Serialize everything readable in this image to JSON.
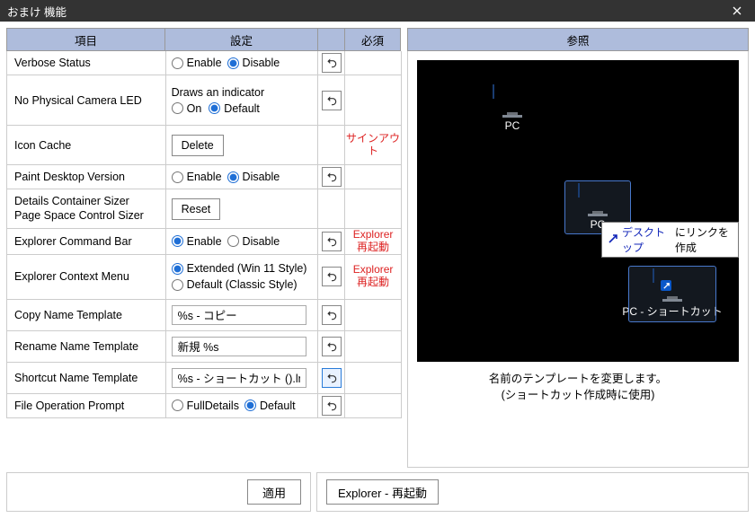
{
  "window": {
    "title": "おまけ 機能"
  },
  "headers": {
    "item": "項目",
    "setting": "設定",
    "required": "必須",
    "reference": "参照"
  },
  "rows": {
    "verbose": {
      "label": "Verbose Status",
      "enable": "Enable",
      "disable": "Disable"
    },
    "led": {
      "label": "No Physical Camera LED",
      "desc": "Draws an indicator",
      "on": "On",
      "def": "Default"
    },
    "cache": {
      "label": "Icon Cache",
      "delete": "Delete",
      "req": "サインアウト"
    },
    "paint": {
      "label": "Paint Desktop Version",
      "enable": "Enable",
      "disable": "Disable"
    },
    "details": {
      "label1": "Details Container Sizer",
      "label2": "Page Space Control Sizer",
      "reset": "Reset"
    },
    "cmdbar": {
      "label": "Explorer Command Bar",
      "enable": "Enable",
      "disable": "Disable",
      "req": "Explorer\n再起動"
    },
    "ctxmenu": {
      "label": "Explorer Context Menu",
      "ext": "Extended (Win 11 Style)",
      "cls": "Default (Classic Style)",
      "req": "Explorer\n再起動"
    },
    "copytpl": {
      "label": "Copy Name Template",
      "value": "%s - コピー"
    },
    "renametpl": {
      "label": "Rename Name Template",
      "value": "新規 %s"
    },
    "sctpl": {
      "label": "Shortcut Name Template",
      "value": "%s - ショートカット ().lnk"
    },
    "fop": {
      "label": "File Operation Prompt",
      "full": "FullDetails",
      "def": "Default"
    }
  },
  "preview": {
    "pc1": "PC",
    "pc2": "PC",
    "sc": "PC - ショートカット",
    "tooltip": {
      "a": "デスクトップ",
      "b": "にリンクを作成"
    },
    "caption1": "名前のテンプレートを変更します。",
    "caption2": "(ショートカット作成時に使用)"
  },
  "buttons": {
    "apply": "適用",
    "explorer": "Explorer - 再起動"
  }
}
